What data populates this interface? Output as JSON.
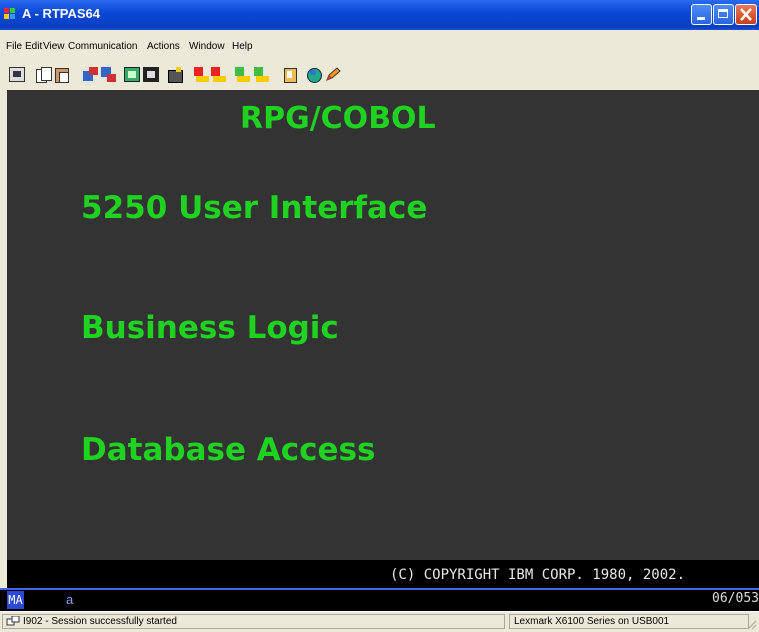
{
  "window": {
    "title": "A - RTPAS64"
  },
  "menu": [
    "File",
    "Edit",
    "View",
    "Communication",
    "Actions",
    "Window",
    "Help"
  ],
  "toolbar": [
    "print-screen-icon",
    "copy-icon",
    "paste-icon",
    "send-icon",
    "receive-icon",
    "display-icon",
    "keypad-icon",
    "macro-icon",
    "record-macro-icon",
    "stop-macro-icon",
    "play-macro-icon",
    "pause-macro-icon",
    "clipboard-icon",
    "globe-icon",
    "pencil-icon"
  ],
  "screen": {
    "heading": "RPG/COBOL",
    "lines": [
      "5250 User Interface",
      "Business Logic",
      "Database Access"
    ],
    "copyright": "(C) COPYRIGHT IBM CORP. 1980, 2002."
  },
  "oia": {
    "mode": "MA",
    "indicator": "a",
    "cursor": "06/053"
  },
  "status": {
    "message": "I902 - Session successfully started",
    "printer": "Lexmark X6100 Series on USB001"
  },
  "colors": {
    "screen_text": "#1fd21f",
    "terminal_bg": "#333333",
    "titlebar": "#0a49d6"
  }
}
